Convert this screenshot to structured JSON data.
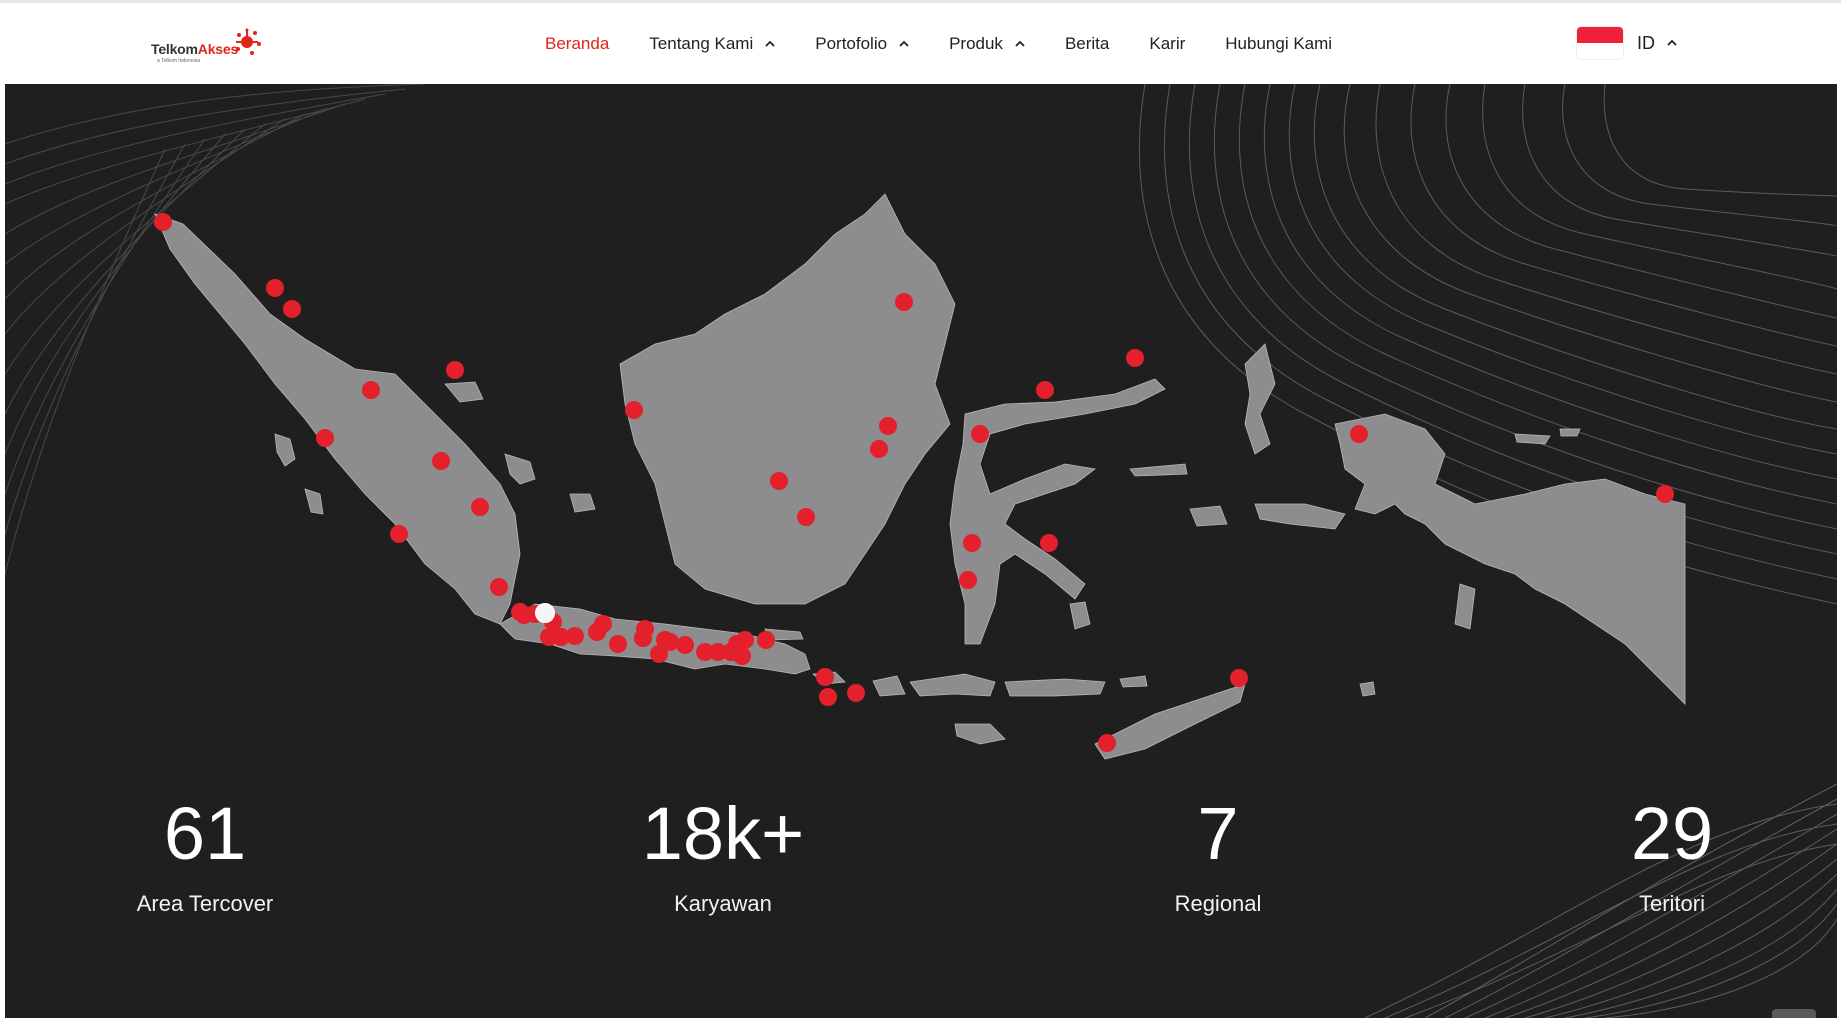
{
  "header": {
    "logo_text_a": "Telkom",
    "logo_text_b": "Akses",
    "logo_tagline": "a Telkom Indonesia",
    "nav": [
      {
        "label": "Beranda",
        "active": true,
        "has_dropdown": false
      },
      {
        "label": "Tentang Kami",
        "active": false,
        "has_dropdown": true
      },
      {
        "label": "Portofolio",
        "active": false,
        "has_dropdown": true
      },
      {
        "label": "Produk",
        "active": false,
        "has_dropdown": true
      },
      {
        "label": "Berita",
        "active": false,
        "has_dropdown": false
      },
      {
        "label": "Karir",
        "active": false,
        "has_dropdown": false
      },
      {
        "label": "Hubungi Kami",
        "active": false,
        "has_dropdown": false
      }
    ],
    "language": {
      "code": "ID",
      "flag": "indonesia-flag-icon"
    }
  },
  "stats": [
    {
      "value": "61",
      "label": "Area Tercover"
    },
    {
      "value": "18k+",
      "label": "Karyawan"
    },
    {
      "value": "7",
      "label": "Regional"
    },
    {
      "value": "29",
      "label": "Teritori"
    }
  ],
  "map": {
    "marker_count": 52,
    "selected_marker_count": 1
  },
  "colors": {
    "accent": "#e1251b",
    "hero_bg": "#1f1f20",
    "land": "#8d8d8f",
    "marker": "#e3202b"
  },
  "icons": {
    "scroll_top": "chevron-up-icon"
  }
}
